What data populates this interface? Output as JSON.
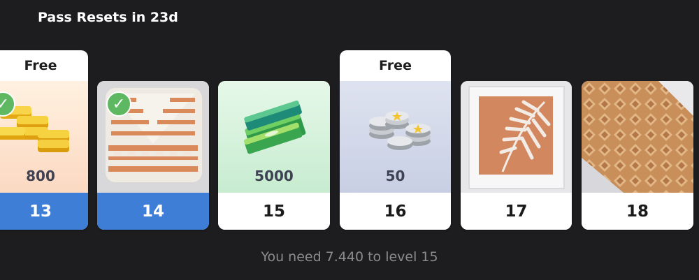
{
  "header": {
    "title": "Pass Resets in 23d"
  },
  "rewards": [
    {
      "level": "13",
      "tag": "Free",
      "amount": "800",
      "item": "gold-coins-icon",
      "claimed": true
    },
    {
      "level": "14",
      "tag": "",
      "amount": "",
      "item": "decor-pillow",
      "claimed": true
    },
    {
      "level": "15",
      "tag": "",
      "amount": "5000",
      "item": "cash-stack-icon",
      "claimed": false
    },
    {
      "level": "16",
      "tag": "Free",
      "amount": "50",
      "item": "silver-coins-icon",
      "claimed": false
    },
    {
      "level": "17",
      "tag": "",
      "amount": "",
      "item": "framed-leaf-art",
      "claimed": false
    },
    {
      "level": "18",
      "tag": "",
      "amount": "",
      "item": "patterned-rug",
      "claimed": false
    }
  ],
  "footer": {
    "progress_text": "You need 7.440 to level 15"
  },
  "colors": {
    "claimed": "#3f7ed6",
    "check": "#5db861",
    "background": "#1d1d1f"
  }
}
